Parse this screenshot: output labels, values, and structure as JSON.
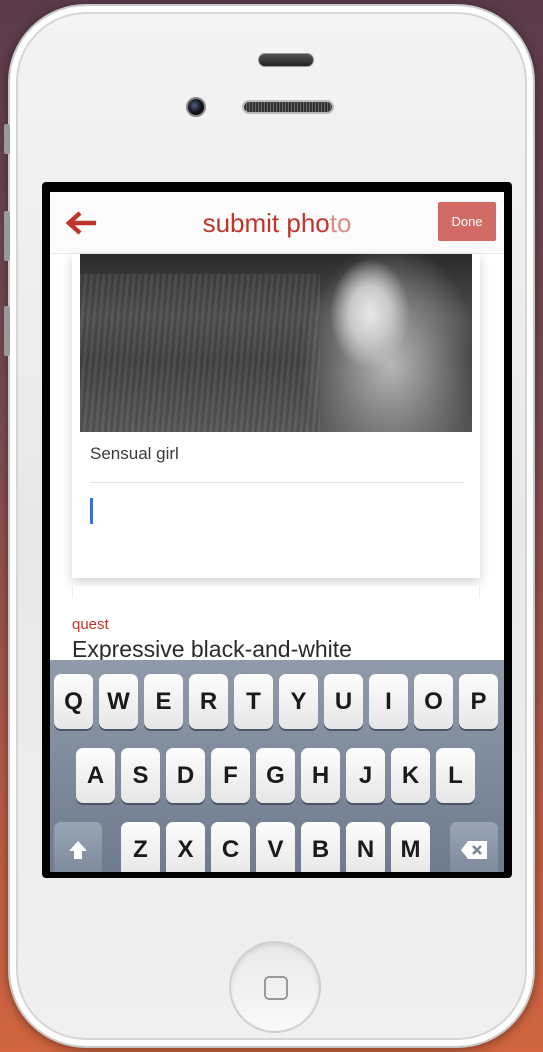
{
  "navbar": {
    "title_main": "submit pho",
    "title_faded": "to",
    "done_label": "Done"
  },
  "card": {
    "caption": "Sensual girl"
  },
  "quest": {
    "label": "quest",
    "text": "Expressive black-and-white"
  },
  "keyboard": {
    "row1": [
      "Q",
      "W",
      "E",
      "R",
      "T",
      "Y",
      "U",
      "I",
      "O",
      "P"
    ],
    "row2": [
      "A",
      "S",
      "D",
      "F",
      "G",
      "H",
      "J",
      "K",
      "L"
    ],
    "row3": [
      "Z",
      "X",
      "C",
      "V",
      "B",
      "N",
      "M"
    ]
  },
  "colors": {
    "accent": "#c0352b",
    "done_button": "#d26a66",
    "cursor": "#3a6fe0"
  },
  "icons": {
    "back": "back-arrow-icon",
    "shift": "shift-icon",
    "delete": "delete-icon",
    "home": "home-button-icon"
  }
}
